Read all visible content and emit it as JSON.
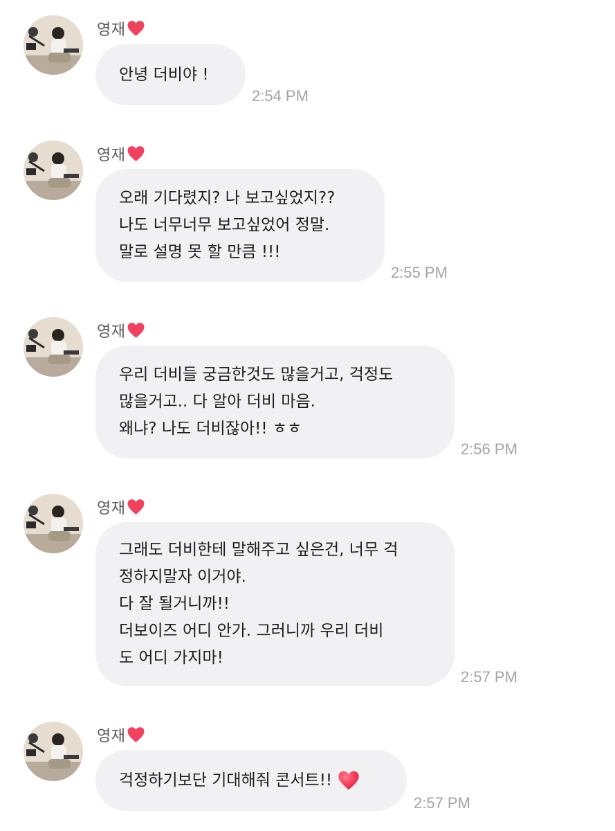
{
  "messages": [
    {
      "sender": "영재",
      "lines": [
        "안녕 더비야 !"
      ],
      "time": "2:54 PM"
    },
    {
      "sender": "영재",
      "lines": [
        "오래 기다렸지? 나 보고싶었지??",
        "나도 너무너무 보고싶었어 정말.",
        "말로 설명 못 할 만큼 !!!"
      ],
      "time": "2:55 PM"
    },
    {
      "sender": "영재",
      "lines": [
        "우리 더비들 궁금한것도 많을거고, 걱정도",
        "많을거고.. 다 알아 더비 마음.",
        "왜냐? 나도 더비잖아!! ㅎㅎ"
      ],
      "time": "2:56 PM"
    },
    {
      "sender": "영재",
      "lines": [
        "그래도 더비한테 말해주고 싶은건, 너무 걱",
        "정하지말자 이거야.",
        "다 잘 될거니까!!",
        "더보이즈 어디 안가. 그러니까 우리 더비",
        "도 어디 가지마!"
      ],
      "time": "2:57 PM"
    },
    {
      "sender": "영재",
      "lines": [
        "걱정하기보단 기대해줘 콘서트!!"
      ],
      "time": "2:57 PM"
    }
  ],
  "icons": {
    "sender_badge": "heart-icon",
    "emoji": "heart-emoji-icon"
  },
  "colors": {
    "bubble": "#f1f1f4",
    "heart": "#f2405f",
    "timestamp": "#a3a3a8",
    "sender_name": "#5a5a5a"
  }
}
